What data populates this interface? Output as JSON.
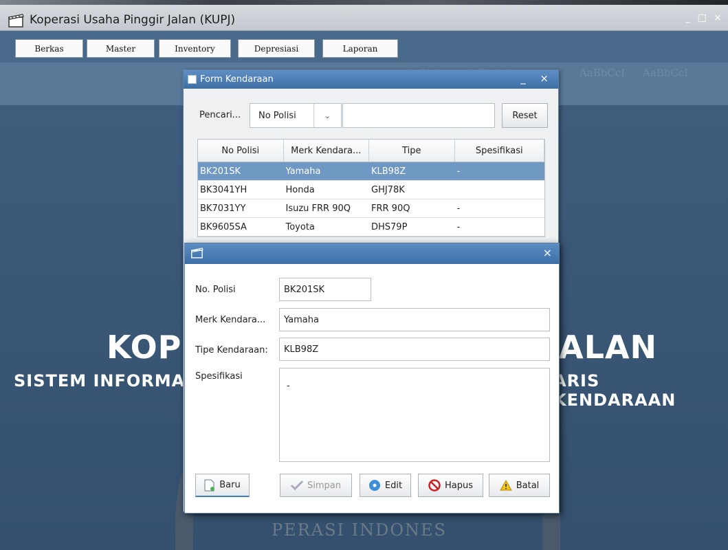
{
  "window": {
    "title": "Koperasi Usaha Pinggir Jalan (KUPJ)",
    "controls": "_ □ ×",
    "icon": "clapperboard-icon"
  },
  "menu": {
    "items": [
      "Berkas",
      "Master",
      "Inventory",
      "Depresiasi",
      "Laporan"
    ]
  },
  "background": {
    "title_left": "KOP",
    "title_right": "ALAN",
    "subtitle_left": "SISTEM INFORMA",
    "subtitle_right": "ARIS KENDARAAN",
    "bottom_text": "PERASI INDONES"
  },
  "form_kendaraan": {
    "title": "Form Kendaraan",
    "controls": "_ ×",
    "search_label": "Pencari...",
    "search_field_selected": "No Polisi",
    "search_value": "",
    "reset_label": "Reset",
    "columns": [
      "No Polisi",
      "Merk Kendara...",
      "Tipe",
      "Spesifikasi"
    ],
    "rows": [
      [
        "BK201SK",
        "Yamaha",
        "KLB98Z",
        "-"
      ],
      [
        "BK3041YH",
        "Honda",
        "GHJ78K",
        ""
      ],
      [
        "BK7031YY",
        "Isuzu FRR 90Q",
        "FRR 90Q",
        "-"
      ],
      [
        "BK9605SA",
        "Toyota",
        "DHS79P",
        "-"
      ]
    ],
    "selected_row": 0
  },
  "detail_dialog": {
    "close": "×",
    "labels": {
      "no_polisi": "No. Polisi",
      "merk": "Merk Kendara...",
      "tipe": "Tipe Kendaraan:",
      "spesifikasi": "Spesifikasi"
    },
    "values": {
      "no_polisi": "BK201SK",
      "merk": "Yamaha",
      "tipe": "KLB98Z",
      "spesifikasi": "-"
    },
    "buttons": {
      "baru": "Baru",
      "simpan": "Simpan",
      "edit": "Edit",
      "hapus": "Hapus",
      "batal": "Batal"
    }
  }
}
